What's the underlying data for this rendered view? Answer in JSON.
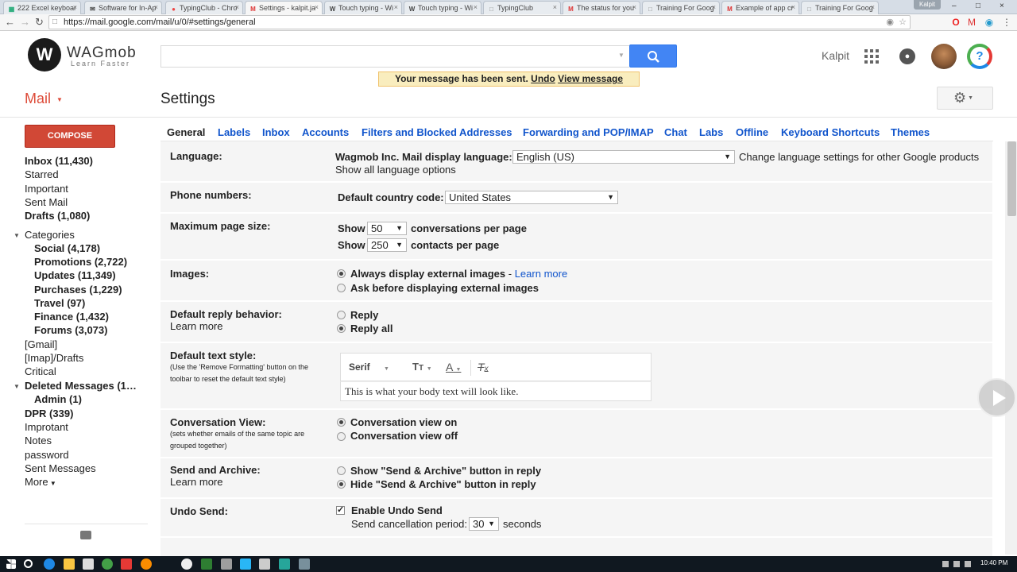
{
  "browser": {
    "tabs": [
      {
        "label": "222 Excel keyboar",
        "icon": "sheet-icon"
      },
      {
        "label": "Software for In-Ap",
        "icon": "mail-icon"
      },
      {
        "label": "TypingClub - Chro",
        "icon": "typingclub-icon"
      },
      {
        "label": "Settings - kalpit.ja",
        "icon": "gmail-icon",
        "active": true
      },
      {
        "label": "Touch typing - Wi",
        "icon": "wikipedia-icon"
      },
      {
        "label": "Touch typing - Wi",
        "icon": "wikipedia-icon"
      },
      {
        "label": "TypingClub",
        "icon": "page-icon"
      },
      {
        "label": "The status for you",
        "icon": "gmail-icon"
      },
      {
        "label": "Training For Goog",
        "icon": "page-icon"
      },
      {
        "label": "Example of app cr",
        "icon": "gmail-icon"
      },
      {
        "label": "Training For Goog",
        "icon": "page-icon"
      }
    ],
    "profile": "Kalpit",
    "url": "https://mail.google.com/mail/u/0/#settings/general"
  },
  "header": {
    "logo_letter": "W",
    "logo_name": "WAGmob",
    "logo_tagline": "Learn Faster",
    "user_name": "Kalpit",
    "help_glyph": "?"
  },
  "banner": {
    "text": "Your message has been sent.",
    "undo": "Undo",
    "view": "View message"
  },
  "mail_label": "Mail",
  "page_title": "Settings",
  "sidebar": {
    "compose": "COMPOSE",
    "items": [
      {
        "label": "Inbox (11,430)",
        "bold": true
      },
      {
        "label": "Starred"
      },
      {
        "label": "Important"
      },
      {
        "label": "Sent Mail"
      },
      {
        "label": "Drafts (1,080)",
        "bold": true
      },
      {
        "label": "Categories"
      },
      {
        "label": "Social (4,178)",
        "bold": true
      },
      {
        "label": "Promotions (2,722)",
        "bold": true
      },
      {
        "label": "Updates (11,349)",
        "bold": true
      },
      {
        "label": "Purchases (1,229)",
        "bold": true
      },
      {
        "label": "Travel (97)",
        "bold": true
      },
      {
        "label": "Finance (1,432)",
        "bold": true
      },
      {
        "label": "Forums (3,073)",
        "bold": true
      },
      {
        "label": "[Gmail]"
      },
      {
        "label": "[Imap]/Drafts"
      },
      {
        "label": "Critical"
      },
      {
        "label": "Deleted Messages (1…",
        "bold": true
      },
      {
        "label": "Admin (1)",
        "bold": true
      },
      {
        "label": "DPR (339)",
        "bold": true
      },
      {
        "label": "Improtant"
      },
      {
        "label": "Notes"
      },
      {
        "label": "password"
      },
      {
        "label": "Sent Messages"
      },
      {
        "label": "More"
      }
    ]
  },
  "settings_tabs": [
    "General",
    "Labels",
    "Inbox",
    "Accounts",
    "Filters and Blocked Addresses",
    "Forwarding and POP/IMAP",
    "Chat",
    "Labs",
    "Offline",
    "Keyboard Shortcuts",
    "Themes"
  ],
  "settings": {
    "language": {
      "label": "Language:",
      "display_label": "Wagmob Inc. Mail display language:",
      "value": "English (US)",
      "change_link": "Change language settings for other Google products",
      "show_all": "Show all language options"
    },
    "phone": {
      "label": "Phone numbers:",
      "code_label": "Default country code:",
      "value": "United States"
    },
    "page_size": {
      "label": "Maximum page size:",
      "show": "Show",
      "conv_value": "50",
      "conv_suffix": "conversations per page",
      "contact_value": "250",
      "contact_suffix": "contacts per page"
    },
    "images": {
      "label": "Images:",
      "opt1": "Always display external images",
      "opt1_sep": "-",
      "learn_more": "Learn more",
      "opt2": "Ask before displaying external images"
    },
    "reply": {
      "label": "Default reply behavior:",
      "learn_more": "Learn more",
      "opt1": "Reply",
      "opt2": "Reply all"
    },
    "text_style": {
      "label": "Default text style:",
      "sub1": "(Use the 'Remove Formatting' button on the",
      "sub2": "toolbar to reset the default text style)",
      "font": "Serif",
      "preview": "This is what your body text will look like."
    },
    "conversation": {
      "label": "Conversation View:",
      "sub1": "(sets whether emails of the same topic are",
      "sub2": "grouped together)",
      "opt1": "Conversation view on",
      "opt2": "Conversation view off"
    },
    "send_archive": {
      "label": "Send and Archive:",
      "learn_more": "Learn more",
      "opt1": "Show \"Send & Archive\" button in reply",
      "opt2": "Hide \"Send & Archive\" button in reply"
    },
    "undo_send": {
      "label": "Undo Send:",
      "enable": "Enable Undo Send",
      "period_label": "Send cancellation period:",
      "period_value": "30",
      "period_suffix": "seconds"
    }
  },
  "taskbar": {
    "time": "10:40 PM"
  }
}
